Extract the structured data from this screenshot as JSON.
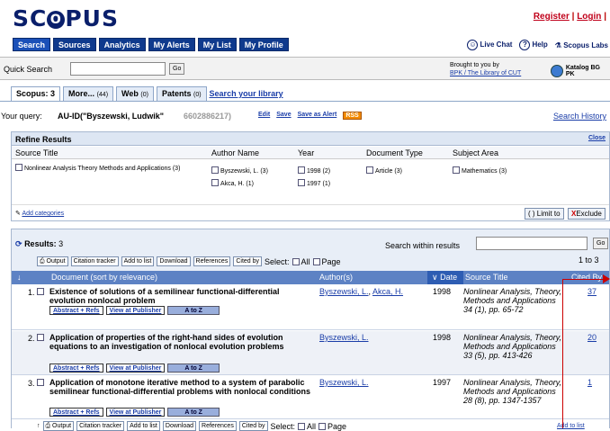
{
  "header": {
    "logo": "SCOPUS",
    "register": "Register",
    "login": "Login",
    "live_chat": "Live Chat",
    "help": "Help",
    "scopus_labs": "Scopus Labs",
    "nav": [
      "Search",
      "Sources",
      "Analytics",
      "My Alerts",
      "My List",
      "My Profile"
    ]
  },
  "quick_search": {
    "label": "Quick Search",
    "value": "",
    "go": "Go",
    "brought_by": "Brought to you by",
    "library_link": "BPK / The Library of CUT",
    "katalog": "Katalog BG PK"
  },
  "tabs": [
    {
      "label": "Scopus:",
      "count": "3"
    },
    {
      "label": "More...",
      "count": "(44)"
    },
    {
      "label": "Web",
      "count": "(0)"
    },
    {
      "label": "Patents",
      "count": "(0)"
    }
  ],
  "search_library": "Search your library",
  "query": {
    "label": "Your query:",
    "value": "AU-ID(\"Byszewski, Ludwik\"",
    "id": "6602886217)",
    "edit": "Edit",
    "save": "Save",
    "save_alert": "Save as Alert",
    "rss": "RSS",
    "history": "Search History"
  },
  "refine": {
    "title": "Refine Results",
    "close": "Close",
    "columns": [
      "Source Title",
      "Author Name",
      "Year",
      "Document Type",
      "Subject Area"
    ],
    "source_titles": [
      "Nonlinear Analysis Theory Methods and Applications (3)"
    ],
    "authors": [
      "Byszewski, L. (3)",
      "Akca, H. (1)"
    ],
    "years": [
      "1998 (2)",
      "1997 (1)"
    ],
    "doc_types": [
      "Article (3)"
    ],
    "subjects": [
      "Mathematics (3)"
    ],
    "add_categories": "Add categories",
    "limit_to": "Limit to",
    "exclude": "Exclude"
  },
  "results": {
    "title": "Results:",
    "count": "3",
    "search_within": "Search within results",
    "go": "Go",
    "pager": "1 to 3",
    "toolbar": [
      "Output",
      "Citation tracker",
      "Add to list",
      "Download",
      "References",
      "Cited by"
    ],
    "select_label": "Select:",
    "select_all": "All",
    "select_page": "Page",
    "columns": {
      "document": "Document (sort by relevance)",
      "authors": "Author(s)",
      "date": "Date",
      "source": "Source Title",
      "cited": "Cited By"
    },
    "rows": [
      {
        "num": "1.",
        "title": "Existence of solutions of a semilinear functional-differential evolution nonlocal problem",
        "authors": [
          "Byszewski, L.",
          "Akca, H."
        ],
        "year": "1998",
        "source": "Nonlinear Analysis, Theory, Methods and Applications 34 (1), pp. 65-72",
        "cited": "37"
      },
      {
        "num": "2.",
        "title": "Application of properties of the right-hand sides of evolution equations to an investigation of nonlocal evolution problems",
        "authors": [
          "Byszewski, L."
        ],
        "year": "1998",
        "source": "Nonlinear Analysis, Theory, Methods and Applications 33 (5), pp. 413-426",
        "cited": "20"
      },
      {
        "num": "3.",
        "title": "Application of monotone iterative method to a system of parabolic semilinear functional-differential problems with nonlocal conditions",
        "authors": [
          "Byszewski, L."
        ],
        "year": "1997",
        "source": "Nonlinear Analysis, Theory, Methods and Applications 28 (8), pp. 1347-1357",
        "cited": "1"
      }
    ],
    "abstract_refs": "Abstract + Refs",
    "view_publisher": "View at Publisher",
    "atoz": "A to Z",
    "add_to_list_bottom": "Add to list"
  }
}
